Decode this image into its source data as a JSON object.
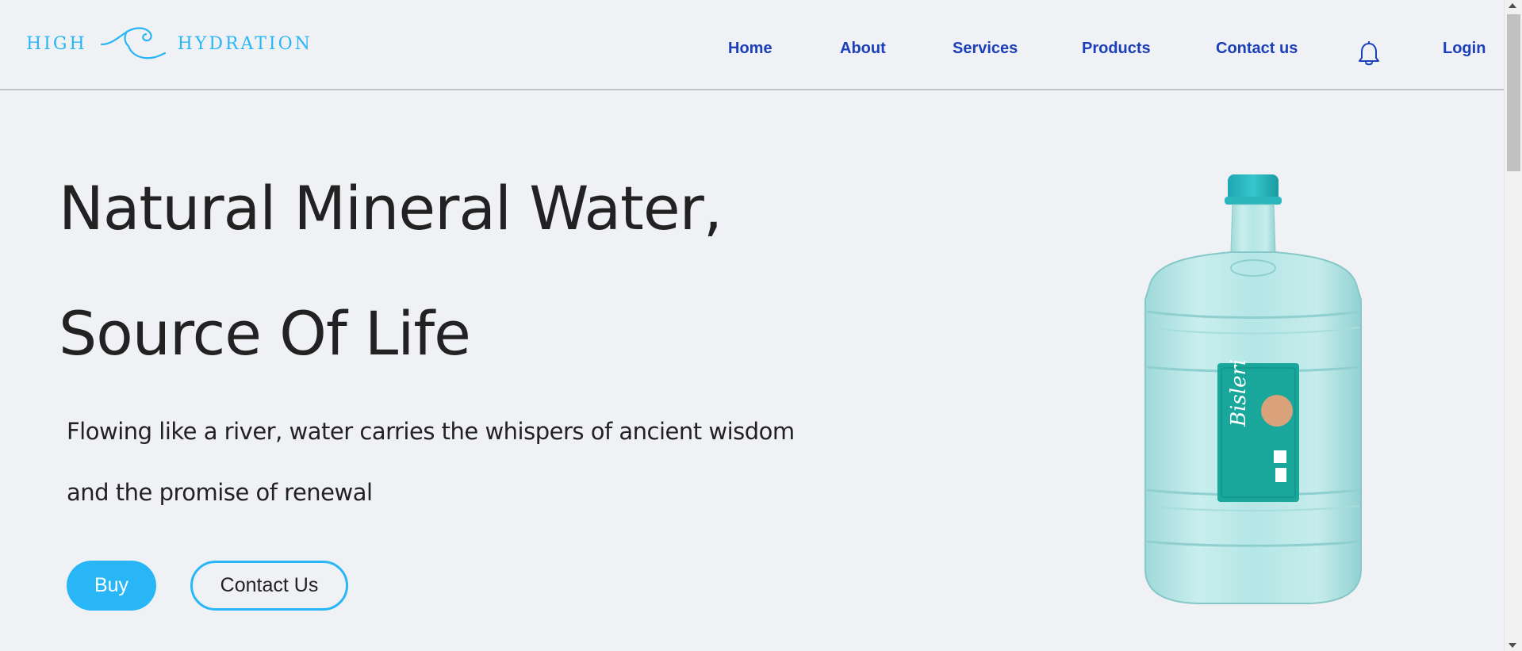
{
  "logo": {
    "word_left": "HIGH",
    "word_right": "HYDRATION",
    "icon": "wave-icon"
  },
  "nav": {
    "items": [
      {
        "label": "Home"
      },
      {
        "label": "About"
      },
      {
        "label": "Services"
      },
      {
        "label": "Products"
      },
      {
        "label": "Contact us"
      }
    ],
    "notification_icon": "bell-icon",
    "login_label": "Login"
  },
  "hero": {
    "title_line1": "Natural Mineral Water,",
    "title_line2": "Source Of Life",
    "subtitle_line1": "Flowing like a river, water carries the whispers of ancient wisdom",
    "subtitle_line2": "and the promise of renewal",
    "buy_label": "Buy",
    "contact_label": "Contact Us",
    "image": "water-bottle-image",
    "bottle_label_brand": "Bisleri"
  },
  "colors": {
    "accent": "#29b6f6",
    "nav_link": "#1b3fb8",
    "background": "#f0f1f5",
    "text": "#222222"
  }
}
